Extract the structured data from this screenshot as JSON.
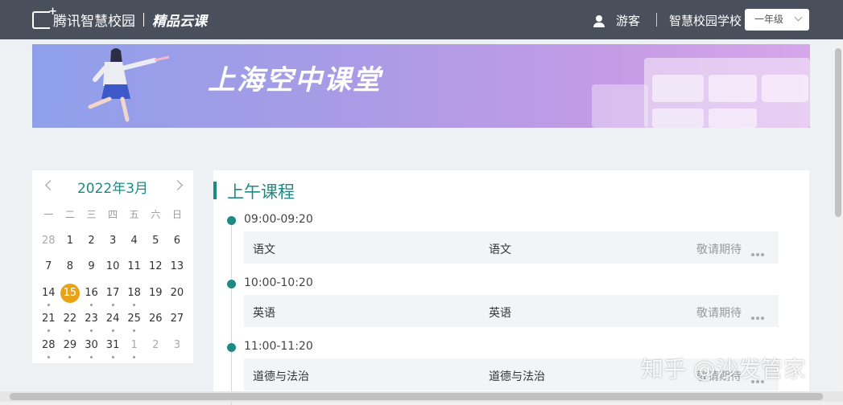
{
  "header": {
    "brand": "腾讯智慧校园",
    "product": "精品云课",
    "user_label": "游客",
    "school": "智慧校园学校",
    "grade": "一年级"
  },
  "banner": {
    "title": "上海空中课堂"
  },
  "calendar": {
    "month_label": "2022年3月",
    "weekdays": [
      "一",
      "二",
      "三",
      "四",
      "五",
      "六",
      "日"
    ],
    "weeks": [
      [
        "28",
        "1",
        "2",
        "3",
        "4",
        "5",
        "6"
      ],
      [
        "7",
        "8",
        "9",
        "10",
        "11",
        "12",
        "13"
      ],
      [
        "14",
        "15",
        "16",
        "17",
        "18",
        "19",
        "20"
      ],
      [
        "21",
        "22",
        "23",
        "24",
        "25",
        "26",
        "27"
      ],
      [
        "28",
        "29",
        "30",
        "31",
        "1",
        "2",
        "3"
      ]
    ],
    "selected": "15"
  },
  "schedule": {
    "title": "上午课程",
    "slots": [
      {
        "time": "09:00-09:20",
        "subject": "语文",
        "name": "语文",
        "status": "敬请期待"
      },
      {
        "time": "10:00-10:20",
        "subject": "英语",
        "name": "英语",
        "status": "敬请期待"
      },
      {
        "time": "11:00-11:20",
        "subject": "道德与法治",
        "name": "道德与法治",
        "status": "敬请期待"
      }
    ]
  },
  "watermark": "知乎 @沙发管家",
  "colors": {
    "accent": "#1e8a83",
    "topbar": "#4a4f5c",
    "selected_day": "#e8a317"
  }
}
